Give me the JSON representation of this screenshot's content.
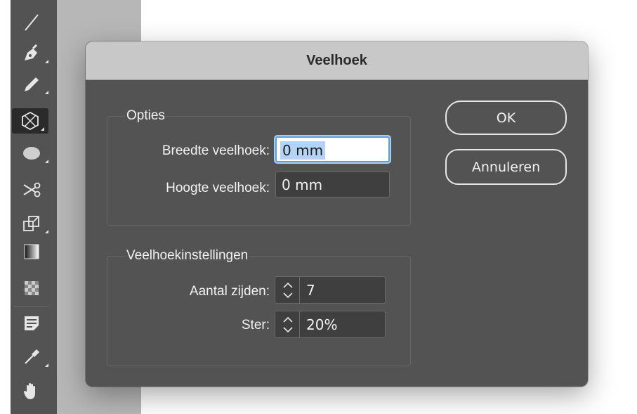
{
  "toolbar": {
    "tools": [
      {
        "icon": "line-icon"
      },
      {
        "icon": "pen-icon"
      },
      {
        "icon": "pencil-icon"
      },
      {
        "icon": "polygon-frame-icon",
        "active": true
      },
      {
        "icon": "ellipse-icon"
      },
      {
        "icon": "scissors-icon"
      },
      {
        "icon": "free-transform-icon"
      },
      {
        "icon": "gradient-swatch-icon"
      },
      {
        "icon": "gradient-feather-icon"
      },
      {
        "icon": "note-icon"
      },
      {
        "icon": "eyedropper-icon"
      },
      {
        "icon": "hand-icon"
      }
    ]
  },
  "dialog": {
    "title": "Veelhoek",
    "options": {
      "title": "Opties",
      "width_label": "Breedte veelhoek:",
      "width_value": "0 mm",
      "height_label": "Hoogte veelhoek:",
      "height_value": "0 mm"
    },
    "polygon_settings": {
      "title": "Veelhoekinstellingen",
      "sides_label": "Aantal zijden:",
      "sides_value": "7",
      "star_label": "Ster:",
      "star_value": "20%"
    },
    "ok_label": "OK",
    "cancel_label": "Annuleren"
  },
  "colors": {
    "dialog_bg": "#535353",
    "titlebar_bg": "#c8c8c8",
    "focus_ring": "#5aa0e6"
  }
}
